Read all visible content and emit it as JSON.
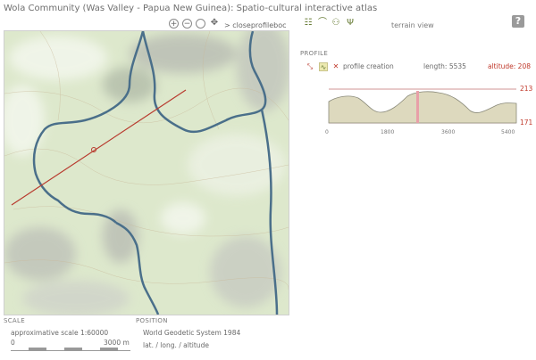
{
  "header": {
    "title": "Wola Community (Was Valley - Papua New Guinea): Spatio-cultural interactive atlas",
    "help_label": "?",
    "terrain_view": "terrain view"
  },
  "map_controls": {
    "zoom_in": "+",
    "zoom_out": "−",
    "close_profile": "> closeprofileboc"
  },
  "profile": {
    "heading": "PROFILE",
    "creation_label": "profile creation",
    "length_label": "length: 5535",
    "altitude_label": "altitude: 208",
    "y_max": "213",
    "y_min": "171",
    "x_ticks": [
      "0",
      "1800",
      "3600",
      "5400"
    ]
  },
  "footer": {
    "scale_heading": "SCALE",
    "scale_text": "approximative scale 1:60000",
    "scale_start": "0",
    "scale_end": "3000 m",
    "position_heading": "POSITION",
    "geodetic_system": "World Geodetic System 1984",
    "coords_label": "lat. / long. / altitude"
  }
}
